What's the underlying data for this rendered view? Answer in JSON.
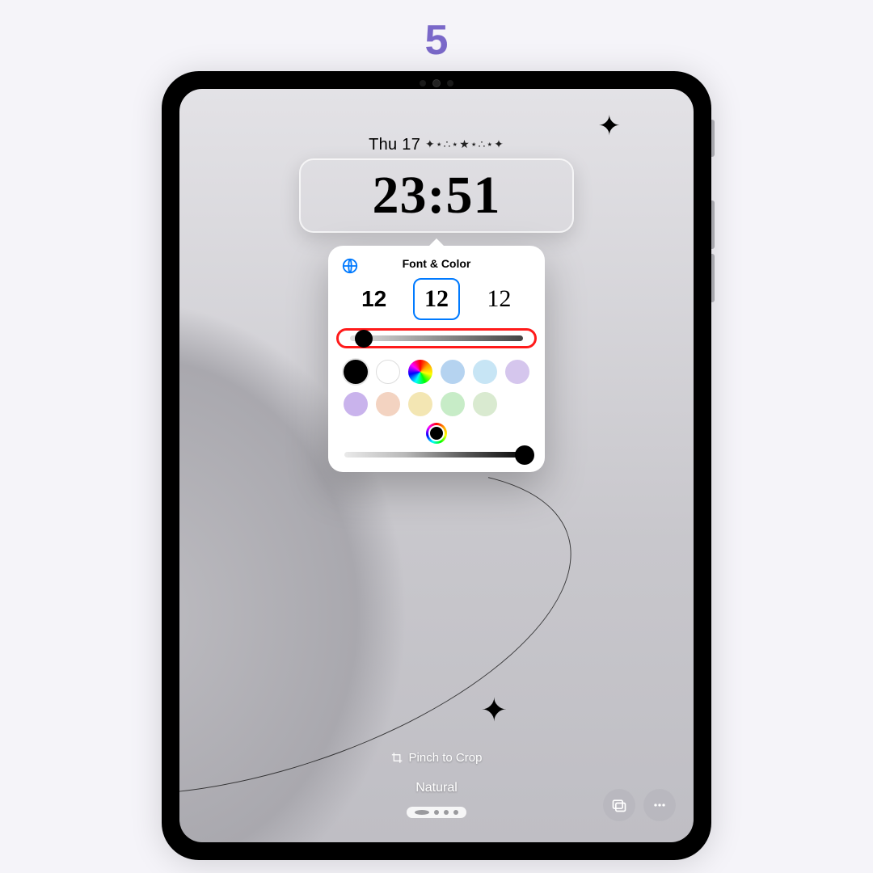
{
  "step_number": "5",
  "lockscreen": {
    "date": "Thu 17",
    "date_decoration": "✦⋆∴⋆★⋆∴⋆✦",
    "time": "23:51"
  },
  "popover": {
    "title": "Font & Color",
    "font_samples": [
      "12",
      "12",
      "12"
    ],
    "selected_font_index": 1,
    "weight_slider_percent": 8,
    "vibrance_slider_percent": 98,
    "swatches": [
      {
        "name": "black",
        "css": "sw-black"
      },
      {
        "name": "white",
        "css": "sw-white"
      },
      {
        "name": "rainbow",
        "css": "sw-rainbow"
      },
      {
        "name": "blue",
        "css": "sw-blue"
      },
      {
        "name": "sky",
        "css": "sw-sky"
      },
      {
        "name": "lilac",
        "css": "sw-lilac"
      },
      {
        "name": "purple",
        "css": "sw-purple"
      },
      {
        "name": "peach",
        "css": "sw-peach"
      },
      {
        "name": "yellow",
        "css": "sw-yellow"
      },
      {
        "name": "mint",
        "css": "sw-mint"
      },
      {
        "name": "sage",
        "css": "sw-sage"
      }
    ],
    "custom_color_selected": "#000000"
  },
  "bottom": {
    "hint": "Pinch to Crop",
    "mode_label": "Natural",
    "page_dots": 4,
    "active_dot": 0
  },
  "annotation": {
    "highlighted": "weight-slider"
  }
}
